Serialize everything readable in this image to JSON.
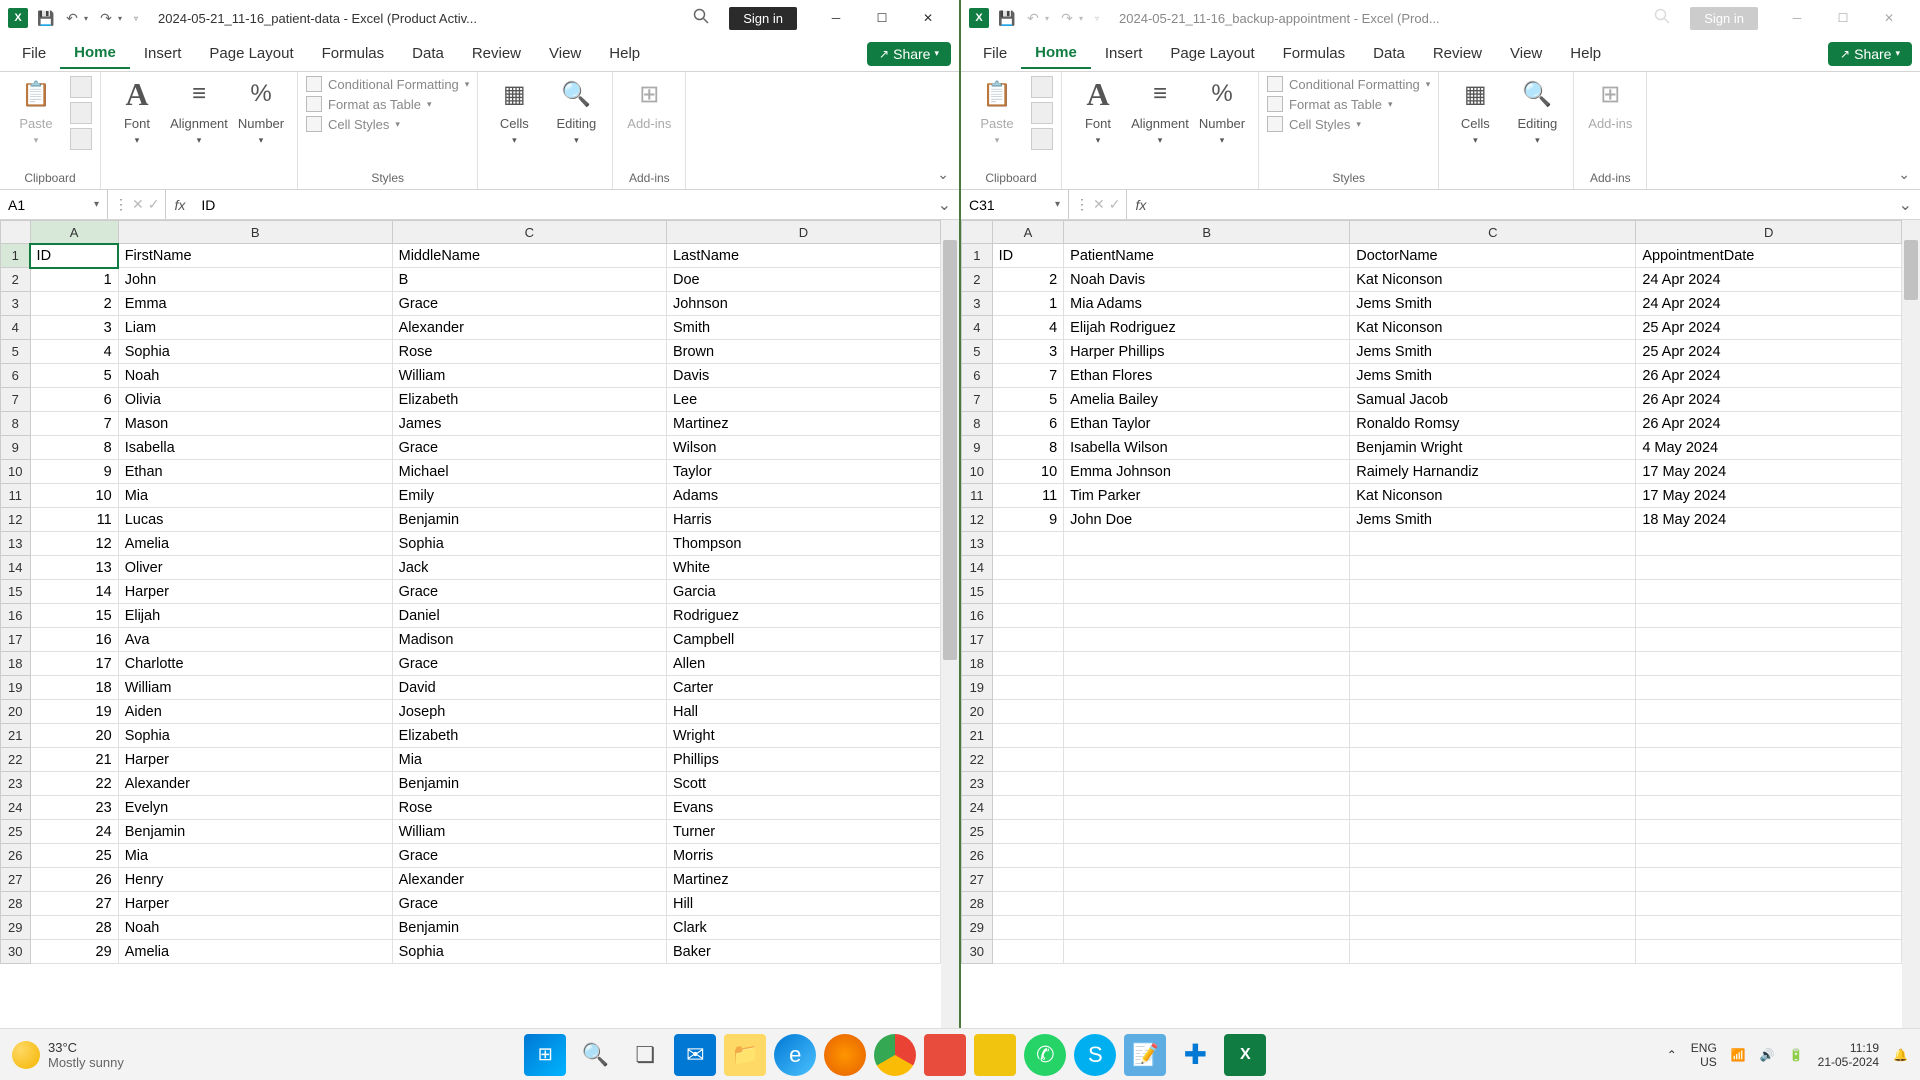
{
  "left": {
    "title": "2024-05-21_11-16_patient-data  -  Excel (Product Activ...",
    "signin": "Sign in",
    "tabs": [
      "File",
      "Home",
      "Insert",
      "Page Layout",
      "Formulas",
      "Data",
      "Review",
      "View",
      "Help"
    ],
    "activeTab": 1,
    "share": "Share",
    "ribbon": {
      "clipboard": "Clipboard",
      "paste": "Paste",
      "font": "Font",
      "alignment": "Alignment",
      "number": "Number",
      "styles": "Styles",
      "cond_fmt": "Conditional Formatting",
      "fmt_table": "Format as Table",
      "cell_styles": "Cell Styles",
      "cells": "Cells",
      "editing": "Editing",
      "addins": "Add-ins",
      "addins_grp": "Add-ins"
    },
    "nameBox": "A1",
    "formula": "ID",
    "columns": [
      "A",
      "B",
      "C",
      "D"
    ],
    "headers": [
      "ID",
      "FirstName",
      "MiddleName",
      "LastName"
    ],
    "rows": [
      [
        1,
        "John",
        "B",
        "Doe"
      ],
      [
        2,
        "Emma",
        "Grace",
        "Johnson"
      ],
      [
        3,
        "Liam",
        "Alexander",
        "Smith"
      ],
      [
        4,
        "Sophia",
        "Rose",
        "Brown"
      ],
      [
        5,
        "Noah",
        "William",
        "Davis"
      ],
      [
        6,
        "Olivia",
        "Elizabeth",
        "Lee"
      ],
      [
        7,
        "Mason",
        "James",
        "Martinez"
      ],
      [
        8,
        "Isabella",
        "Grace",
        "Wilson"
      ],
      [
        9,
        "Ethan",
        "Michael",
        "Taylor"
      ],
      [
        10,
        "Mia",
        "Emily",
        "Adams"
      ],
      [
        11,
        "Lucas",
        "Benjamin",
        "Harris"
      ],
      [
        12,
        "Amelia",
        "Sophia",
        "Thompson"
      ],
      [
        13,
        "Oliver",
        "Jack",
        "White"
      ],
      [
        14,
        "Harper",
        "Grace",
        "Garcia"
      ],
      [
        15,
        "Elijah",
        "Daniel",
        "Rodriguez"
      ],
      [
        16,
        "Ava",
        "Madison",
        "Campbell"
      ],
      [
        17,
        "Charlotte",
        "Grace",
        "Allen"
      ],
      [
        18,
        "William",
        "David",
        "Carter"
      ],
      [
        19,
        "Aiden",
        "Joseph",
        "Hall"
      ],
      [
        20,
        "Sophia",
        "Elizabeth",
        "Wright"
      ],
      [
        21,
        "Harper",
        "Mia",
        "Phillips"
      ],
      [
        22,
        "Alexander",
        "Benjamin",
        "Scott"
      ],
      [
        23,
        "Evelyn",
        "Rose",
        "Evans"
      ],
      [
        24,
        "Benjamin",
        "William",
        "Turner"
      ],
      [
        25,
        "Mia",
        "Grace",
        "Morris"
      ],
      [
        26,
        "Henry",
        "Alexander",
        "Martinez"
      ],
      [
        27,
        "Harper",
        "Grace",
        "Hill"
      ],
      [
        28,
        "Noah",
        "Benjamin",
        "Clark"
      ],
      [
        29,
        "Amelia",
        "Sophia",
        "Baker"
      ]
    ],
    "selectedCell": {
      "row": 0,
      "col": 0
    }
  },
  "right": {
    "title": "2024-05-21_11-16_backup-appointment  -  Excel (Prod...",
    "signin": "Sign in",
    "tabs": [
      "File",
      "Home",
      "Insert",
      "Page Layout",
      "Formulas",
      "Data",
      "Review",
      "View",
      "Help"
    ],
    "activeTab": 1,
    "share": "Share",
    "ribbon": {
      "clipboard": "Clipboard",
      "paste": "Paste",
      "font": "Font",
      "alignment": "Alignment",
      "number": "Number",
      "styles": "Styles",
      "cond_fmt": "Conditional Formatting",
      "fmt_table": "Format as Table",
      "cell_styles": "Cell Styles",
      "cells": "Cells",
      "editing": "Editing",
      "addins": "Add-ins",
      "addins_grp": "Add-ins"
    },
    "nameBox": "C31",
    "formula": "",
    "columns": [
      "A",
      "B",
      "C",
      "D"
    ],
    "headers": [
      "ID",
      "PatientName",
      "DoctorName",
      "AppointmentDate"
    ],
    "rows": [
      [
        2,
        "Noah Davis",
        "Kat Niconson",
        "24 Apr 2024"
      ],
      [
        1,
        "Mia Adams",
        "Jems Smith",
        "24 Apr 2024"
      ],
      [
        4,
        "Elijah Rodriguez",
        "Kat Niconson",
        "25 Apr 2024"
      ],
      [
        3,
        "Harper Phillips",
        "Jems Smith",
        "25 Apr 2024"
      ],
      [
        7,
        "Ethan Flores",
        "Jems Smith",
        "26 Apr 2024"
      ],
      [
        5,
        "Amelia Bailey",
        "Samual Jacob",
        "26 Apr 2024"
      ],
      [
        6,
        "Ethan Taylor",
        "Ronaldo Romsy",
        "26 Apr 2024"
      ],
      [
        8,
        "Isabella Wilson",
        "Benjamin Wright",
        "4 May 2024"
      ],
      [
        10,
        "Emma Johnson",
        "Raimely Harnandiz",
        "17 May 2024"
      ],
      [
        11,
        "Tim Parker",
        "Kat Niconson",
        "17 May 2024"
      ],
      [
        9,
        "John Doe",
        "Jems Smith",
        "18 May 2024"
      ]
    ],
    "emptyRows": 18
  },
  "taskbar": {
    "weather_temp": "33°C",
    "weather_desc": "Mostly sunny",
    "lang1": "ENG",
    "lang2": "US",
    "time": "11:19",
    "date": "21-05-2024"
  }
}
